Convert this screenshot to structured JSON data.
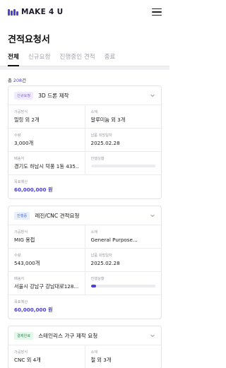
{
  "header": {
    "logo_text": "MAKE 4 U",
    "brand_color": "#4a3fd6"
  },
  "page": {
    "title": "견적요청서"
  },
  "tabs": [
    {
      "label": "전체",
      "active": true
    },
    {
      "label": "신규요청",
      "active": false
    },
    {
      "label": "진행중인 견적",
      "active": false
    },
    {
      "label": "종료",
      "active": false
    }
  ],
  "summary": {
    "prefix": "총 ",
    "count": "208",
    "suffix": "건"
  },
  "labels": {
    "method": "가공방식",
    "material": "소재",
    "quantity": "수량",
    "due": "납품 희망일자",
    "location": "배송지",
    "progress": "진행상황",
    "budget": "목표예산"
  },
  "cards": [
    {
      "badge": "신규요청",
      "title": "3D 드론 제작",
      "method": "밀링 외 2개",
      "material": "알루미늄 외 3개",
      "quantity": "3,000개",
      "due": "2025.02.28",
      "location": "경기도 하남시 덕풍 1동 435...",
      "progress": 0,
      "budget": "60,000,000 원"
    },
    {
      "badge": "진행중",
      "title": "레진/CNC 견적요청",
      "method": "MIG 용접",
      "material": "General Purpose...",
      "quantity": "543,000개",
      "due": "2025.02.28",
      "location": "서울시 강남구 강남대로128...",
      "progress": 0.08,
      "budget": "60,000,000 원"
    },
    {
      "badge": "결제완료",
      "title": "스테인리스 가구 제작 요청",
      "method": "CNC 외 4개",
      "material": "철 외 3개"
    }
  ]
}
